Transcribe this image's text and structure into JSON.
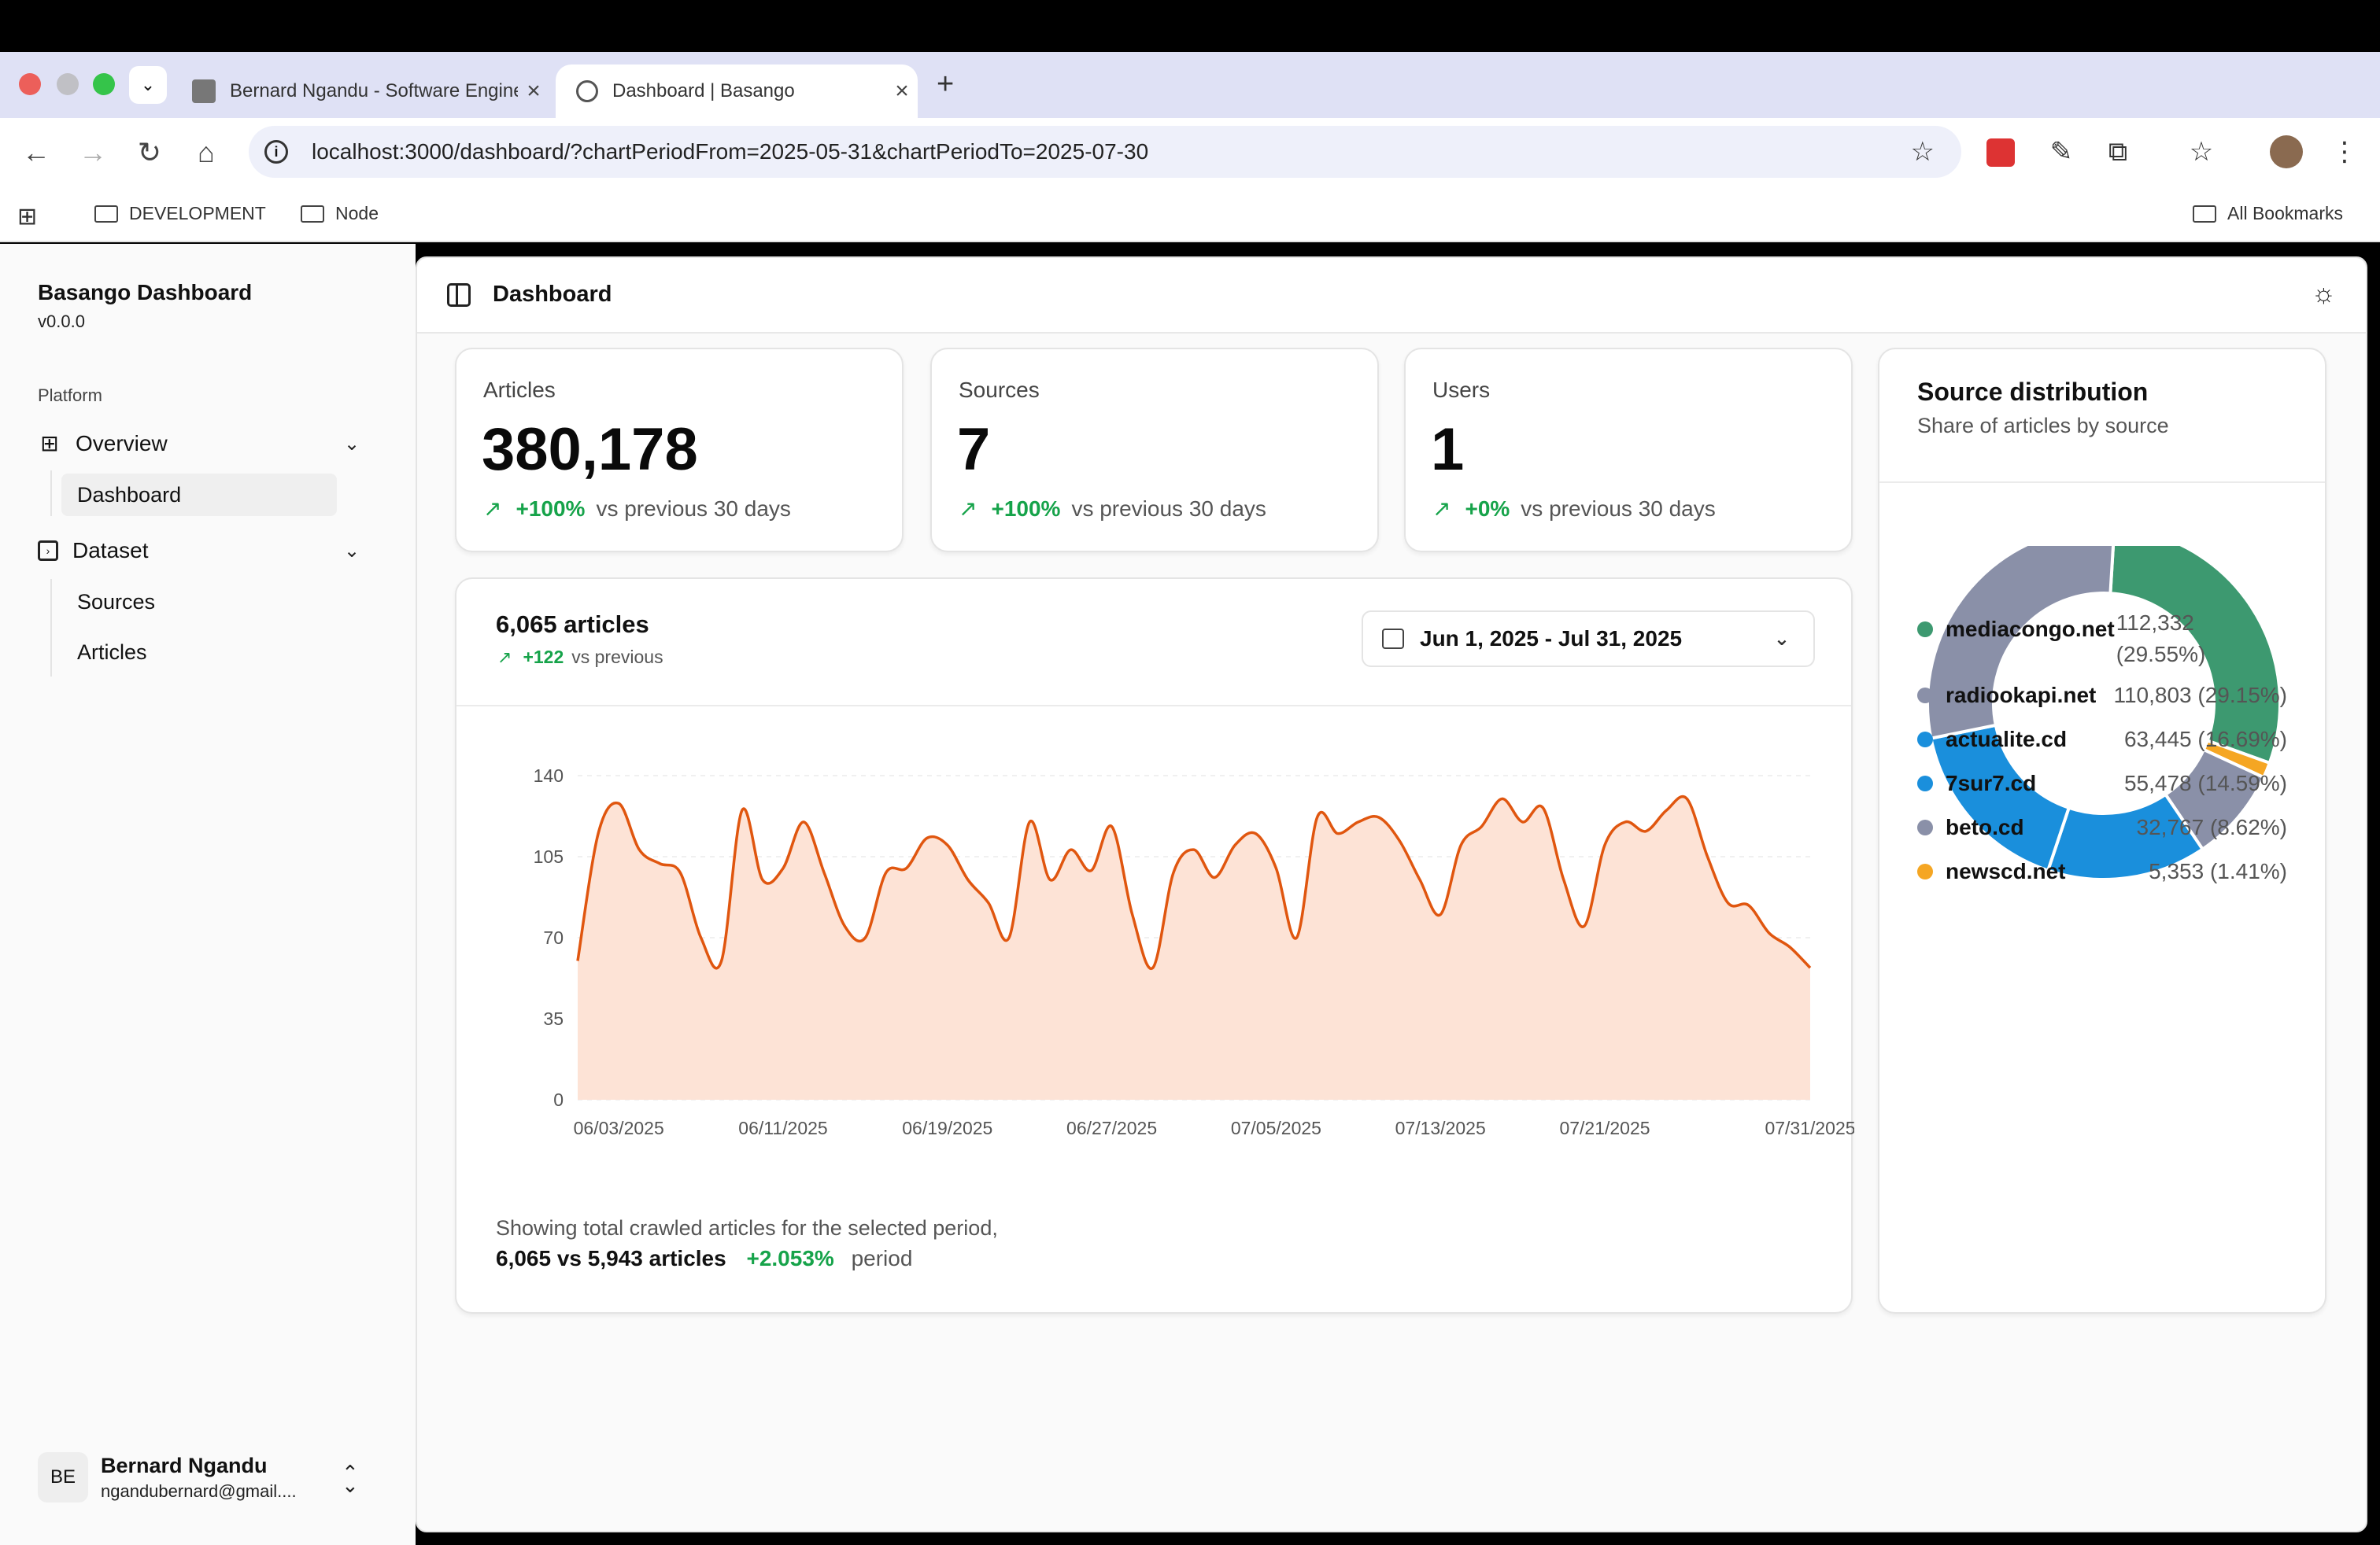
{
  "browser": {
    "tabs": [
      {
        "title": "Bernard Ngandu - Software Engineer"
      },
      {
        "title": "Dashboard | Basango"
      }
    ],
    "url": "localhost:3000/dashboard/?chartPeriodFrom=2025-05-31&chartPeriodTo=2025-07-30",
    "bookmarks": [
      "DEVELOPMENT",
      "Node"
    ],
    "all_bookmarks": "All Bookmarks"
  },
  "sidebar": {
    "brand": "Basango Dashboard",
    "version": "v0.0.0",
    "section": "Platform",
    "groups": [
      {
        "label": "Overview",
        "items": [
          "Dashboard"
        ]
      },
      {
        "label": "Dataset",
        "items": [
          "Sources",
          "Articles"
        ]
      }
    ],
    "user": {
      "initials": "BE",
      "name": "Bernard Ngandu",
      "email": "ngandubernard@gmail...."
    }
  },
  "header": {
    "title": "Dashboard"
  },
  "stats": [
    {
      "label": "Articles",
      "value": "380,178",
      "delta": "+100%",
      "suffix": "vs previous 30 days"
    },
    {
      "label": "Sources",
      "value": "7",
      "delta": "+100%",
      "suffix": "vs previous 30 days"
    },
    {
      "label": "Users",
      "value": "1",
      "delta": "+0%",
      "suffix": "vs previous 30 days"
    }
  ],
  "articles_chart": {
    "title": "6,065 articles",
    "delta": "+122",
    "delta_suffix": "vs previous",
    "range": "Jun 1, 2025 - Jul 31, 2025",
    "footer_text": "Showing total crawled articles for the selected period,",
    "footer_compare": "6,065 vs 5,943 articles",
    "footer_delta": "+2.053%",
    "footer_period": "period"
  },
  "distribution": {
    "title": "Source distribution",
    "subtitle": "Share of articles by source"
  },
  "colors": {
    "accent": "#e0560f",
    "fill": "#fde3d6",
    "up": "#16a34a"
  },
  "chart_data": [
    {
      "type": "area",
      "x_ticks": [
        "06/03/2025",
        "06/11/2025",
        "06/19/2025",
        "06/27/2025",
        "07/05/2025",
        "07/13/2025",
        "07/21/2025",
        "07/31/2025"
      ],
      "y_ticks": [
        0,
        35,
        70,
        105,
        140
      ],
      "ylim": [
        0,
        140
      ],
      "x": [
        "06/01/2025",
        "06/02/2025",
        "06/03/2025",
        "06/04/2025",
        "06/05/2025",
        "06/06/2025",
        "06/07/2025",
        "06/08/2025",
        "06/09/2025",
        "06/10/2025",
        "06/11/2025",
        "06/12/2025",
        "06/13/2025",
        "06/14/2025",
        "06/15/2025",
        "06/16/2025",
        "06/17/2025",
        "06/18/2025",
        "06/19/2025",
        "06/20/2025",
        "06/21/2025",
        "06/22/2025",
        "06/23/2025",
        "06/24/2025",
        "06/25/2025",
        "06/26/2025",
        "06/27/2025",
        "06/28/2025",
        "06/29/2025",
        "06/30/2025",
        "07/01/2025",
        "07/02/2025",
        "07/03/2025",
        "07/04/2025",
        "07/05/2025",
        "07/06/2025",
        "07/07/2025",
        "07/08/2025",
        "07/09/2025",
        "07/10/2025",
        "07/11/2025",
        "07/12/2025",
        "07/13/2025",
        "07/14/2025",
        "07/15/2025",
        "07/16/2025",
        "07/17/2025",
        "07/18/2025",
        "07/19/2025",
        "07/20/2025",
        "07/21/2025",
        "07/22/2025",
        "07/23/2025",
        "07/24/2025",
        "07/25/2025",
        "07/26/2025",
        "07/27/2025",
        "07/28/2025",
        "07/29/2025",
        "07/30/2025",
        "07/31/2025"
      ],
      "values": [
        60,
        115,
        128,
        108,
        102,
        98,
        70,
        60,
        125,
        95,
        100,
        120,
        98,
        75,
        70,
        98,
        100,
        113,
        110,
        95,
        85,
        70,
        120,
        95,
        108,
        99,
        118,
        80,
        57,
        98,
        108,
        96,
        110,
        115,
        100,
        70,
        122,
        115,
        120,
        122,
        112,
        95,
        80,
        110,
        118,
        130,
        120,
        126,
        95,
        75,
        110,
        120,
        116,
        125,
        130,
        105,
        85,
        84,
        72,
        66,
        57
      ],
      "series": [
        {
          "name": "Articles"
        }
      ]
    },
    {
      "type": "pie",
      "labels": [
        "mediacongo.net",
        "radiookapi.net",
        "actualite.cd",
        "7sur7.cd",
        "beto.cd",
        "newscd.net"
      ],
      "values": [
        112332,
        110803,
        63445,
        55478,
        32767,
        5353
      ],
      "display": [
        "112,332 (29.55%)",
        "110,803 (29.15%)",
        "63,445 (16.69%)",
        "55,478 (14.59%)",
        "32,767 (8.62%)",
        "5,353 (1.41%)"
      ],
      "percent": [
        29.55,
        29.15,
        16.69,
        14.59,
        8.62,
        1.41
      ],
      "colors": [
        "#3d9970",
        "#8a90a8",
        "#1a8fdc",
        "#1a8fdc",
        "#8a90a8",
        "#f5a623"
      ],
      "clockwise_order": [
        "mediacongo.net",
        "newscd.net",
        "beto.cd",
        "7sur7.cd",
        "actualite.cd",
        "radiookapi.net"
      ]
    }
  ]
}
